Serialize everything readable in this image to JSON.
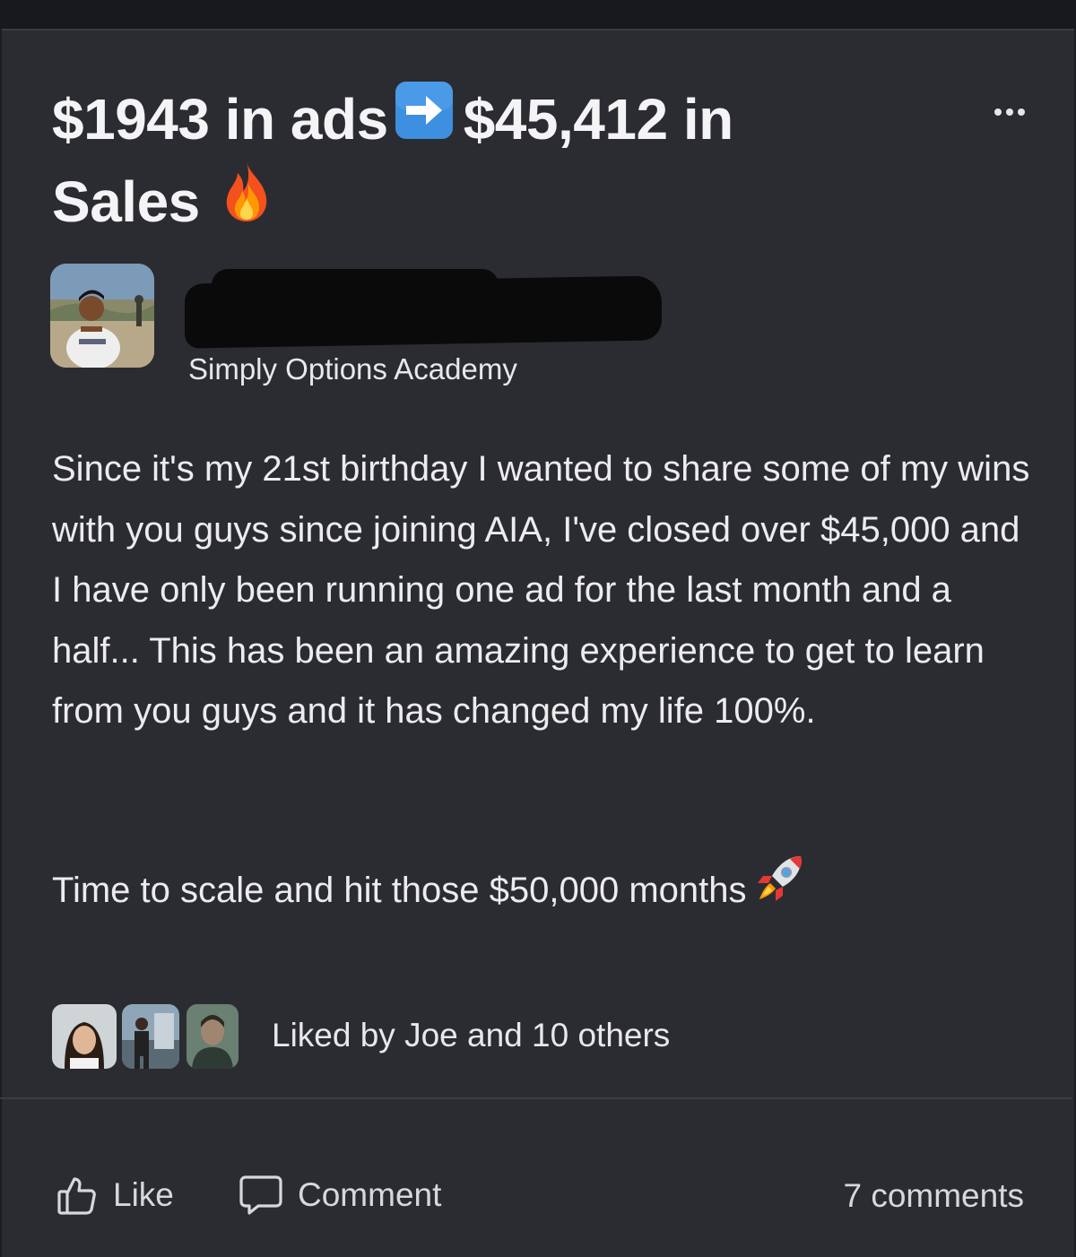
{
  "post": {
    "title_part1": "$1943 in ads",
    "arrow_icon": "right-arrow-emoji",
    "title_part2": "$45,412 in Sales",
    "fire_icon": "fire-emoji",
    "author": {
      "group": "Simply Options Academy"
    },
    "body": "Since it's my 21st birthday I wanted to share some of my wins with you guys since joining AIA, I've closed over $45,000 and I have only been running one ad for the last month and a half... This has been an amazing experience to get to learn from you guys and it has changed my life 100%.",
    "closing": "Time to scale and hit those $50,000 months",
    "rocket_icon": "rocket-emoji",
    "likes_summary": "Liked by Joe and 10 others"
  },
  "actions": {
    "like_label": "Like",
    "comment_label": "Comment",
    "comments_count": "7 comments"
  },
  "colors": {
    "background": "#2b2c31",
    "text": "#f2f2f3",
    "arrow_emoji_bg": "#3d8fe0"
  }
}
